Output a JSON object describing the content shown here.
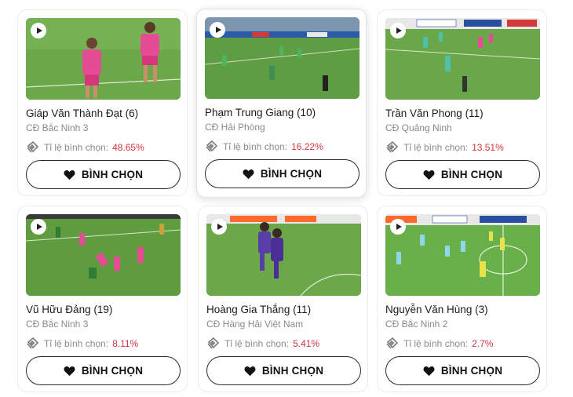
{
  "vote_label": "BÌNH CHỌN",
  "rate_label": "Tỉ lệ bình chọn:",
  "accent_color": "#d4353b",
  "icons": {
    "play": "play-icon",
    "ticket": "ticket-icon",
    "heart": "heart-icon"
  },
  "players": [
    {
      "name": "Giáp Văn Thành Đạt (6)",
      "team": "CĐ Bắc Ninh 3",
      "rate": "48.65%"
    },
    {
      "name": "Phạm Trung Giang (10)",
      "team": "CĐ Hải Phòng",
      "rate": "16.22%"
    },
    {
      "name": "Trần Văn Phong (11)",
      "team": "CĐ Quảng Ninh",
      "rate": "13.51%"
    },
    {
      "name": "Vũ Hữu Đảng (19)",
      "team": "CĐ Bắc Ninh 3",
      "rate": "8.11%"
    },
    {
      "name": "Hoàng Gia Thắng (11)",
      "team": "CĐ Hàng Hải Việt Nam",
      "rate": "5.41%"
    },
    {
      "name": "Nguyễn Văn Hùng (3)",
      "team": "CĐ Bắc Ninh 2",
      "rate": "2.7%"
    }
  ]
}
